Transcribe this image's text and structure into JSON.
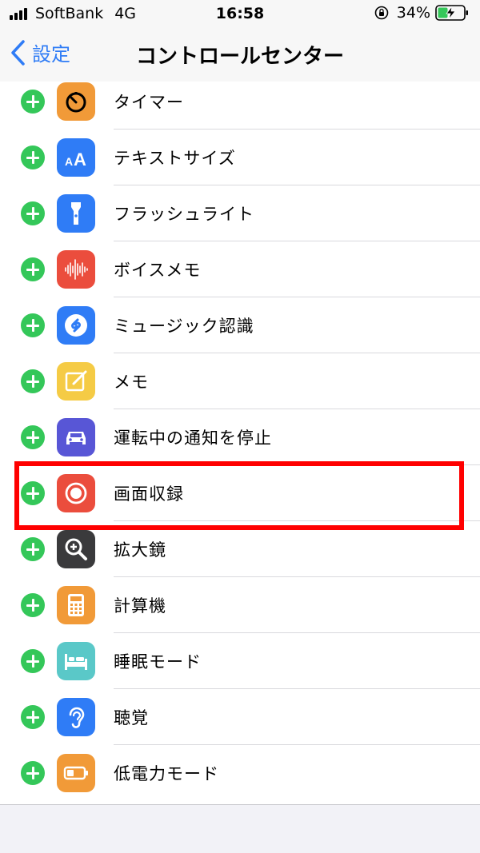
{
  "status_bar": {
    "carrier": "SoftBank",
    "network": "4G",
    "time": "16:58",
    "battery_percent": "34%"
  },
  "nav": {
    "back_label": "設定",
    "title": "コントロールセンター"
  },
  "colors": {
    "accent": "#2f7cf6",
    "add_green": "#34c759",
    "highlight": "#ff0000"
  },
  "items": [
    {
      "label": "タイマー",
      "icon": "timer-icon",
      "color": "#f19a38"
    },
    {
      "label": "テキストサイズ",
      "icon": "text-size-icon",
      "color": "#2f7cf6"
    },
    {
      "label": "フラッシュライト",
      "icon": "flashlight-icon",
      "color": "#2f7cf6"
    },
    {
      "label": "ボイスメモ",
      "icon": "voice-memo-icon",
      "color": "#eb4d3d"
    },
    {
      "label": "ミュージック認識",
      "icon": "shazam-icon",
      "color": "#2f7cf6"
    },
    {
      "label": "メモ",
      "icon": "notes-icon",
      "color": "#f5cb45"
    },
    {
      "label": "運転中の通知を停止",
      "icon": "car-icon",
      "color": "#5856d6"
    },
    {
      "label": "画面収録",
      "icon": "screen-record-icon",
      "color": "#eb4d3d"
    },
    {
      "label": "拡大鏡",
      "icon": "magnifier-icon",
      "color": "#3a3a3c"
    },
    {
      "label": "計算機",
      "icon": "calculator-icon",
      "color": "#f19a38"
    },
    {
      "label": "睡眠モード",
      "icon": "bed-icon",
      "color": "#5ac8c8"
    },
    {
      "label": "聴覚",
      "icon": "ear-icon",
      "color": "#2f7cf6"
    },
    {
      "label": "低電力モード",
      "icon": "low-power-icon",
      "color": "#f19a38"
    }
  ]
}
